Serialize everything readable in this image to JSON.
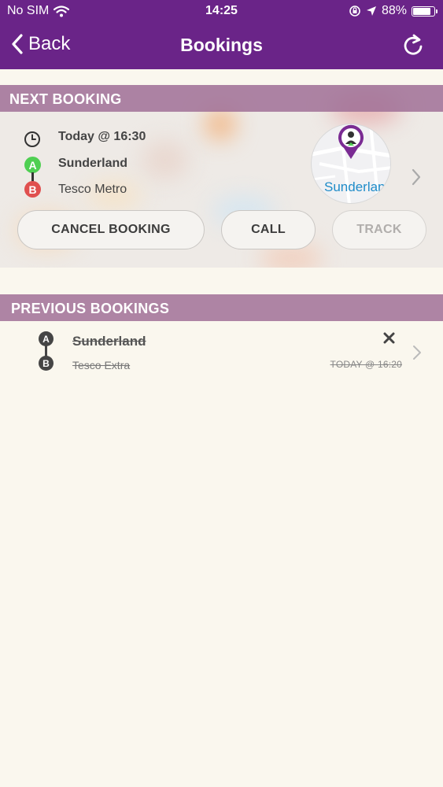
{
  "status_bar": {
    "carrier": "No SIM",
    "time": "14:25",
    "battery": "88%",
    "battery_level": 0.88
  },
  "nav": {
    "back_label": "Back",
    "title": "Bookings",
    "refresh_icon": "refresh-icon"
  },
  "next_booking": {
    "header": "NEXT BOOKING",
    "time": "Today @ 16:30",
    "pickup": "Sunderland",
    "dropoff": "Tesco Metro",
    "pickup_marker": "A",
    "dropoff_marker": "B",
    "map_label": "Sunderland",
    "buttons": {
      "cancel": "CANCEL BOOKING",
      "call": "CALL",
      "track": "TRACK"
    },
    "colors": {
      "pickup": "#4fcf52",
      "dropoff": "#e0504f"
    }
  },
  "previous_bookings": {
    "header": "PREVIOUS BOOKINGS",
    "items": [
      {
        "pickup_marker": "A",
        "dropoff_marker": "B",
        "pickup": "Sunderland",
        "dropoff": "Tesco Extra",
        "time": "TODAY @ 16:20",
        "status_icon": "cancelled-x-icon"
      }
    ]
  },
  "colors": {
    "brand": "#6a2488",
    "section_header": "#a07096",
    "background": "#faf7ee"
  }
}
